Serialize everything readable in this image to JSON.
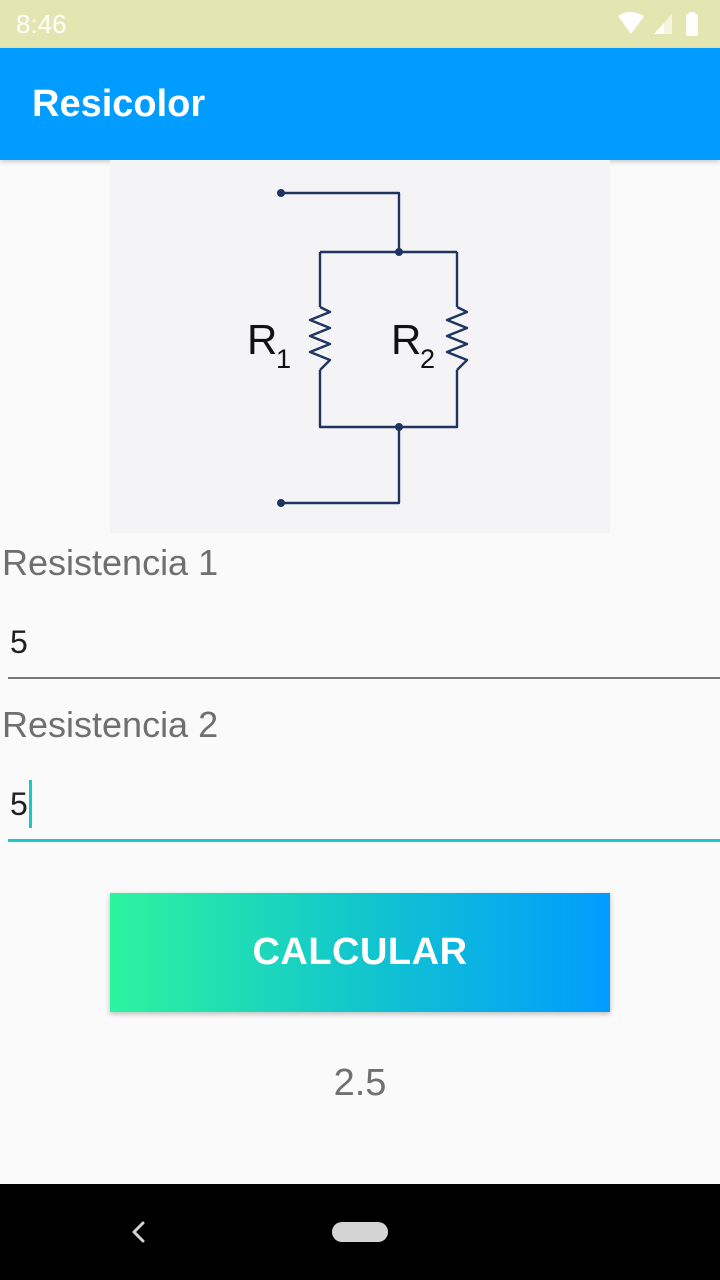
{
  "status_bar": {
    "time": "8:46",
    "icons": [
      "wifi-icon",
      "cellular-signal-icon",
      "battery-icon"
    ],
    "background": "#e3e6b0"
  },
  "app_bar": {
    "title": "Resicolor",
    "background": "#009cff"
  },
  "circuit": {
    "labels": {
      "r1_letter": "R",
      "r1_sub": "1",
      "r2_letter": "R",
      "r2_sub": "2"
    }
  },
  "form": {
    "resistance1_label": "Resistencia 1",
    "resistance1_value": "5",
    "resistance2_label": "Resistencia 2",
    "resistance2_value": "5",
    "focused_field": "resistance2",
    "accent": "#1cc8c4"
  },
  "button": {
    "label": "CALCULAR",
    "gradient": [
      "#2df49e",
      "#019cff"
    ]
  },
  "result": {
    "value": "2.5"
  },
  "nav_bar": {
    "icons": [
      "back-icon",
      "home-pill-icon"
    ]
  }
}
